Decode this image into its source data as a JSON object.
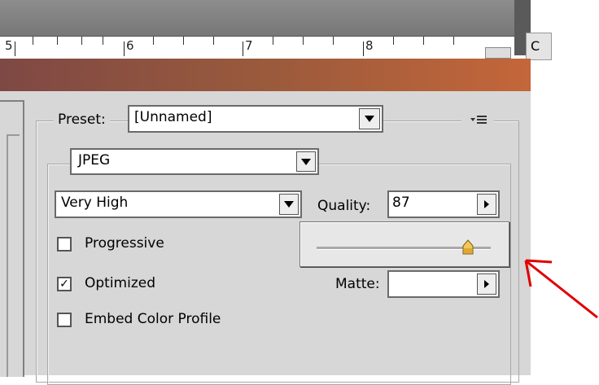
{
  "ruler": {
    "labels": [
      "5",
      "6",
      "7",
      "8"
    ]
  },
  "side_tab": {
    "label": "C"
  },
  "preset": {
    "label": "Preset:",
    "value": "[Unnamed]"
  },
  "format": {
    "value": "JPEG"
  },
  "quality_preset": {
    "value": "Very High"
  },
  "quality": {
    "label": "Quality:",
    "value": "87",
    "fraction": 0.87
  },
  "options": {
    "progressive": {
      "label": "Progressive",
      "checked": false
    },
    "optimized": {
      "label": "Optimized",
      "checked": true
    },
    "embed_color_profile": {
      "label": "Embed Color Profile",
      "checked": false
    }
  },
  "matte": {
    "label": "Matte:",
    "value": ""
  },
  "icons": {
    "panel_menu": "panel-menu-icon",
    "check": "✓",
    "arrow": "red-annotation-arrow"
  },
  "colors": {
    "title_gradient_start": "#7e4844",
    "title_gradient_end": "#c4663a",
    "panel_bg": "#d7d7d7",
    "annotation": "#e00000"
  }
}
